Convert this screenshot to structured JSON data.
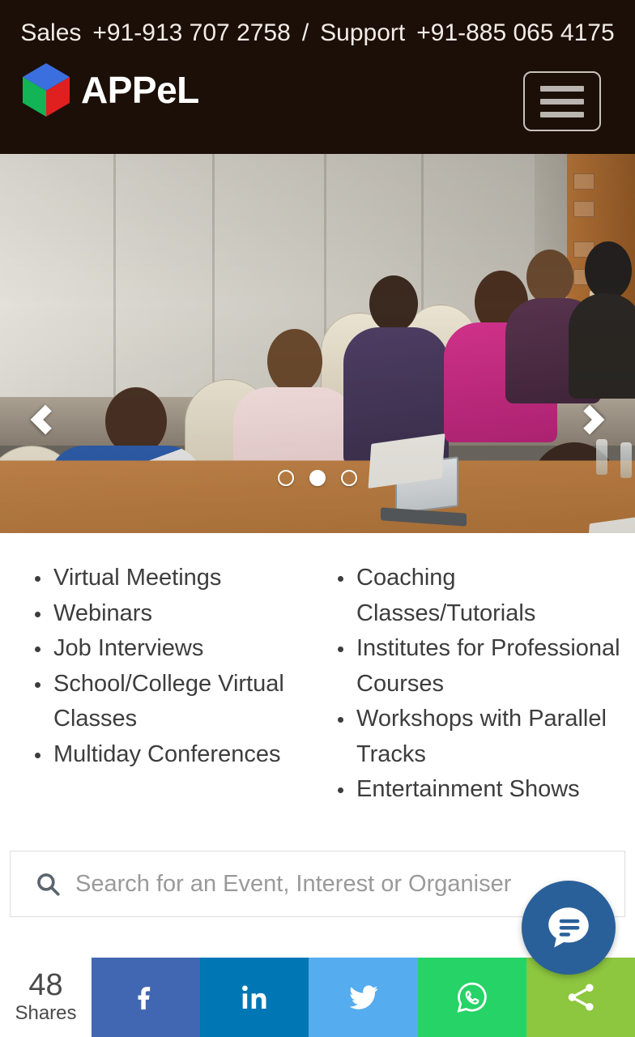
{
  "header": {
    "contact": {
      "sales_label": "Sales",
      "sales_phone": "+91-913 707 2758",
      "separator": "/",
      "support_label": "Support",
      "support_phone": "+91-885 065 4175"
    },
    "brand_name": "APPeL",
    "logo_icon": "cube-logo-icon",
    "logo_colors": {
      "top": "#3b6fe0",
      "left": "#12b455",
      "right": "#e01f1f"
    },
    "menu_icon": "hamburger-menu-icon",
    "background_color": "#1b0f07",
    "text_color": "#f3ece7"
  },
  "carousel": {
    "prev_icon": "chevron-left-icon",
    "next_icon": "chevron-right-icon",
    "slide_alt": "People seated around a conference room table in a meeting",
    "dots": [
      {
        "index": 1,
        "active": false
      },
      {
        "index": 2,
        "active": true
      },
      {
        "index": 3,
        "active": false
      }
    ],
    "active_index": 2,
    "total_slides": 3
  },
  "features": {
    "left_column": [
      "Virtual Meetings",
      "Webinars",
      "Job Interviews",
      "School/College Virtual Classes",
      "Multiday Conferences"
    ],
    "right_column": [
      "Coaching Classes/Tutorials",
      "Institutes for Professional Courses",
      "Workshops with Parallel Tracks",
      "Entertainment Shows"
    ]
  },
  "search": {
    "icon": "search-icon",
    "placeholder": "Search for an Event, Interest or Organiser",
    "value": ""
  },
  "chat": {
    "icon": "chat-bubble-icon",
    "color": "#2a6099"
  },
  "share_bar": {
    "count": "48",
    "count_label": "Shares",
    "buttons": [
      {
        "name": "facebook",
        "icon": "facebook-icon",
        "color": "#4267B2"
      },
      {
        "name": "linkedin",
        "icon": "linkedin-icon",
        "color": "#0077B5"
      },
      {
        "name": "twitter",
        "icon": "twitter-icon",
        "color": "#55ACEE"
      },
      {
        "name": "whatsapp",
        "icon": "whatsapp-icon",
        "color": "#25D366"
      },
      {
        "name": "share",
        "icon": "share-nodes-icon",
        "color": "#8DC63F"
      }
    ]
  }
}
